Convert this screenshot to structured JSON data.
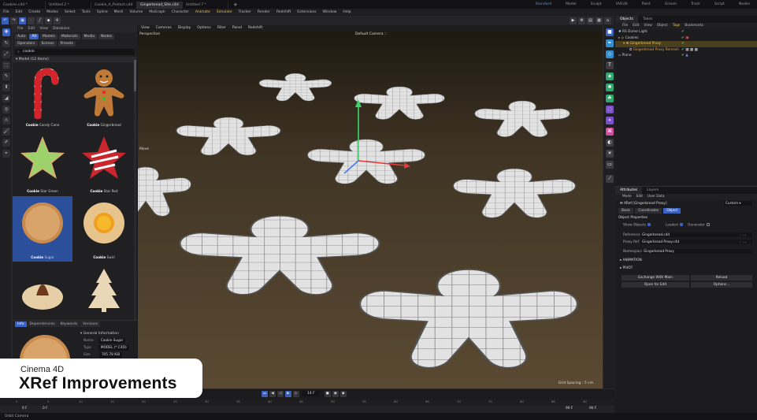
{
  "window_tabs": [
    "Cookies.c4d *",
    "Untitled 2 *",
    "Cookie_A_Protect.c4d",
    "Gingerbread_Site.c4d",
    "Untitled 7 *"
  ],
  "layouts": [
    "Standard",
    "Model",
    "Sculpt",
    "UVEdit",
    "Paint",
    "Groom",
    "Track",
    "Script",
    "Nodes"
  ],
  "menu": [
    "File",
    "Edit",
    "Create",
    "Modes",
    "Select",
    "Tools",
    "Spline",
    "Mesh",
    "Volume",
    "MoGraph",
    "Character",
    "Animate",
    "Simulate",
    "Tracker",
    "Render",
    "Redshift",
    "Extensions",
    "Window",
    "Help"
  ],
  "viewport": {
    "menu": [
      "View",
      "Cameras",
      "Display",
      "Options",
      "Filter",
      "Panel",
      "Redshift"
    ],
    "camera_label": "Default Camera ::",
    "perspective_label": "Perspective",
    "move_label": "Move ",
    "grid_spacing": "Grid Spacing : 5 cm"
  },
  "asset_browser": {
    "header": [
      "File",
      "Edit",
      "View",
      "Database"
    ],
    "chips": [
      "Auto",
      "All",
      "Models",
      "Materials",
      "Media",
      "Nodes",
      "Operators",
      "Scenes",
      "Presets"
    ],
    "search_value": "cookie",
    "group": "Model (12 Items)",
    "items": [
      {
        "bold": "Cookie",
        "rest": " Candy Cane"
      },
      {
        "bold": "Cookie",
        "rest": " Gingerbread"
      },
      {
        "bold": "Cookie",
        "rest": " Star Green"
      },
      {
        "bold": "Cookie",
        "rest": " Star Red"
      },
      {
        "bold": "Cookie",
        "rest": " Sugar"
      },
      {
        "bold": "Cookie",
        "rest": " Swirl"
      }
    ]
  },
  "info": {
    "tabs": [
      "Info",
      "Dependencies",
      "Keywords",
      "Versions"
    ],
    "section": "General Information",
    "rows": [
      {
        "k": "Name",
        "v": "Cookie Sugar"
      },
      {
        "k": "Type",
        "v": "MODEL (*.C4D)"
      },
      {
        "k": "Size",
        "v": "705.78 KiB"
      }
    ]
  },
  "objects_panel": {
    "tabs": [
      "Objects",
      "Takes"
    ],
    "menu": [
      "File",
      "Edit",
      "View",
      "Object",
      "Tags",
      "Bookmarks"
    ],
    "items": [
      "RS Dome Light",
      "Cookies",
      "Gingerbread Proxy",
      "Gingerbread Proxy Remesh",
      "Plane"
    ]
  },
  "attributes_panel": {
    "tabs": [
      "Attributes",
      "Layers"
    ],
    "menu": [
      "Mode",
      "Edit",
      "User Data"
    ],
    "object_title": "XRef [Gingerbread Proxy]",
    "mode_value": "Custom",
    "buttons": [
      "Basic",
      "Coordinates",
      "Object"
    ],
    "section": "Object Properties",
    "show_objects": "Show Objects",
    "loaded": "Loaded",
    "generator": "Generator",
    "reference_label": "Reference",
    "reference_value": "Gingerbread.c4d",
    "proxy_label": "Proxy Ref",
    "proxy_value": "Gingerbread Proxy.c4d",
    "namespace_label": "Namespace",
    "namespace_value": "Gingerbread Proxy",
    "groups": [
      "ANIMATION",
      "PIVOT"
    ],
    "actions": [
      "Exchange With Main",
      "Reload",
      "Open for Edit",
      "Options..."
    ]
  },
  "timeline": {
    "frame": "14 F",
    "start": "0 F",
    "start2": "0 F",
    "end": "90 F",
    "end2": "90 F",
    "ticks": [
      "0",
      "5",
      "10",
      "15",
      "20",
      "25",
      "30",
      "35",
      "40",
      "45",
      "50",
      "55",
      "60",
      "65",
      "70",
      "75",
      "80",
      "85",
      "90"
    ]
  },
  "status": "Orbit Camera",
  "card": {
    "subtitle": "Cinema 4D",
    "title": "XRef Improvements"
  },
  "colors": {
    "accent": "#3a62c4",
    "highlight": "#e6c552",
    "card_bg": "#ffffff"
  }
}
